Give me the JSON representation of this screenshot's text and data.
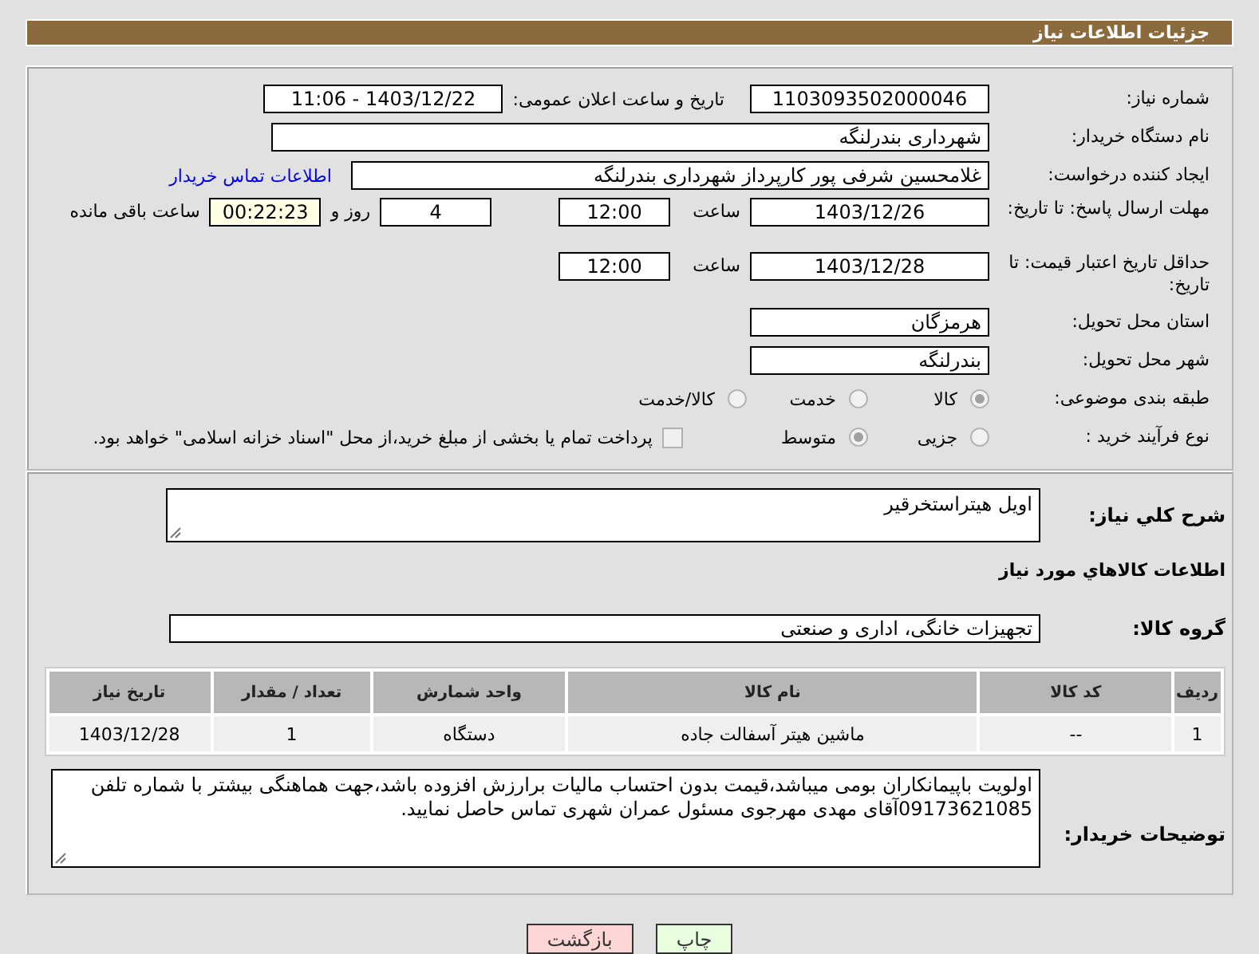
{
  "header": {
    "title": "جزئیات اطلاعات نیاز"
  },
  "need_number": {
    "label": "شماره نیاز:",
    "value": "1103093502000046"
  },
  "announce": {
    "label": "تاریخ و ساعت اعلان عمومی:",
    "value": "1403/12/22 - 11:06"
  },
  "buyer_org": {
    "label": "نام دستگاه خریدار:",
    "value": "شهرداری بندرلنگه"
  },
  "requester": {
    "label": "ایجاد کننده درخواست:",
    "value": "غلامحسین شرفی پور کارپرداز شهرداری بندرلنگه",
    "link": "اطلاعات تماس خریدار"
  },
  "reply_deadline": {
    "label": "مهلت ارسال پاسخ: تا تاریخ:",
    "date": "1403/12/26",
    "time_label": "ساعت",
    "time": "12:00",
    "days": "4",
    "days_label": "روز و",
    "remaining": "00:22:23",
    "remaining_label": "ساعت باقی مانده"
  },
  "price_validity": {
    "label": "حداقل تاریخ اعتبار قیمت: تا تاریخ:",
    "date": "1403/12/28",
    "time_label": "ساعت",
    "time": "12:00"
  },
  "province": {
    "label": "استان محل تحویل:",
    "value": "هرمزگان"
  },
  "city": {
    "label": "شهر محل تحویل:",
    "value": "بندرلنگه"
  },
  "category": {
    "label": "طبقه بندی موضوعی:",
    "options": [
      {
        "label": "کالا",
        "selected": true
      },
      {
        "label": "خدمت",
        "selected": false
      },
      {
        "label": "کالا/خدمت",
        "selected": false
      }
    ]
  },
  "purchase_type": {
    "label": "نوع فرآیند خرید :",
    "options": [
      {
        "label": "جزیی",
        "selected": false
      },
      {
        "label": "متوسط",
        "selected": true
      }
    ],
    "payment": {
      "checked": false,
      "text": "پرداخت تمام یا بخشی از مبلغ خرید،از محل \"اسناد خزانه اسلامی\" خواهد بود."
    }
  },
  "description": {
    "label": "شرح کلي نياز:",
    "value": "اویل هیتراستخرقیر"
  },
  "goods_title": "اطلاعات کالاهاي مورد نياز",
  "goods_group": {
    "label": "گروه کالا:",
    "value": "تجهیزات خانگی، اداری و صنعتی"
  },
  "table": {
    "columns": [
      "ردیف",
      "کد کالا",
      "نام کالا",
      "واحد شمارش",
      "تعداد / مقدار",
      "تاریخ نیاز"
    ],
    "rows": [
      [
        "1",
        "--",
        "ماشین هیتر آسفالت جاده",
        "دستگاه",
        "1",
        "1403/12/28"
      ]
    ]
  },
  "buyer_notes": {
    "label": "توضیحات خریدار:",
    "value": "اولویت باپیمانکاران بومی میباشد،قیمت بدون احتساب مالیات برارزش افزوده باشد،جهت هماهنگی بیشتر با شماره تلفن 09173621085آقای مهدی مهرجوی مسئول عمران شهری تماس حاصل نمایید."
  },
  "buttons": [
    {
      "label": "چاپ",
      "kind": "print"
    },
    {
      "label": "بازگشت",
      "kind": "back"
    }
  ]
}
